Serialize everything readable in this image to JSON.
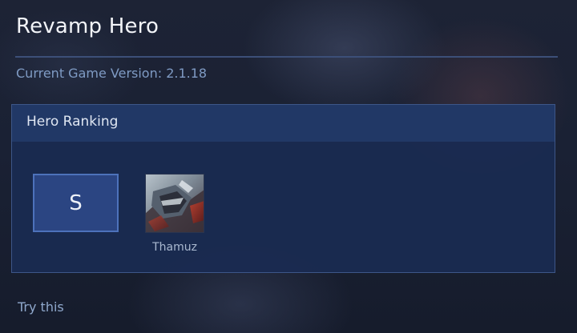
{
  "header": {
    "title": "Revamp Hero",
    "version": "Current Game Version: 2.1.18"
  },
  "ranking": {
    "heading": "Hero Ranking",
    "tier": "S",
    "heroes": [
      {
        "name": "Thamuz",
        "icon": "hero-portrait-thamuz"
      }
    ]
  },
  "footer": {
    "try_this": "Try this"
  },
  "colors": {
    "accent_border": "#4d72bb",
    "panel_bg": "#1a2b52",
    "text_muted": "#7f9bc4"
  }
}
